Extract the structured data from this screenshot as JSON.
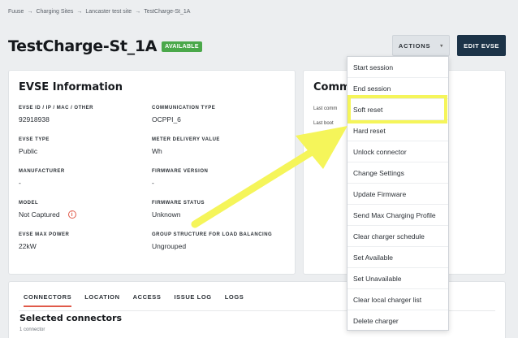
{
  "breadcrumb": {
    "items": [
      "Fuuse",
      "Charging Sites",
      "Lancaster test site",
      "TestCharge-St_1A"
    ],
    "separator": "→"
  },
  "header": {
    "title": "TestCharge-St_1A",
    "status_badge": "AVAILABLE",
    "actions_label": "ACTIONS",
    "edit_label": "EDIT EVSE"
  },
  "evse_info": {
    "heading": "EVSE Information",
    "fields": [
      {
        "label": "EVSE ID / IP / MAC / OTHER",
        "value": "92918938"
      },
      {
        "label": "COMMUNICATION TYPE",
        "value": "OCPPI_6"
      },
      {
        "label": "EVSE TYPE",
        "value": "Public"
      },
      {
        "label": "METER DELIVERY VALUE",
        "value": "Wh"
      },
      {
        "label": "MANUFACTURER",
        "value": "-"
      },
      {
        "label": "FIRMWARE VERSION",
        "value": "-"
      },
      {
        "label": "MODEL",
        "value": "Not Captured"
      },
      {
        "label": "FIRMWARE STATUS",
        "value": "Unknown"
      },
      {
        "label": "EVSE MAX POWER",
        "value": "22kW"
      },
      {
        "label": "GROUP STRUCTURE FOR LOAD BALANCING",
        "value": "Ungrouped"
      }
    ]
  },
  "comm_card": {
    "heading": "Comm",
    "line1": "Last comm",
    "line2": "Last boot"
  },
  "actions_menu": {
    "items": [
      "Start session",
      "End session",
      "Soft reset",
      "Hard reset",
      "Unlock connector",
      "Change Settings",
      "Update Firmware",
      "Send Max Charging Profile",
      "Clear charger schedule",
      "Set Available",
      "Set Unavailable",
      "Clear local charger list",
      "Delete charger"
    ],
    "highlighted": "Soft reset"
  },
  "bottom": {
    "tabs": [
      "CONNECTORS",
      "LOCATION",
      "ACCESS",
      "ISSUE LOG",
      "LOGS"
    ],
    "active_tab": "CONNECTORS",
    "selected_title": "Selected connectors",
    "selected_sub": "1 connector"
  },
  "colors": {
    "badge": "#4aa84a",
    "edit_button": "#1c3348",
    "highlight": "#f5f55a",
    "accent": "#e05a4a"
  },
  "icons": {
    "breadcrumb_separator": "arrow-right-icon",
    "actions_caret": "caret-down-icon",
    "model_info": "info-icon"
  }
}
